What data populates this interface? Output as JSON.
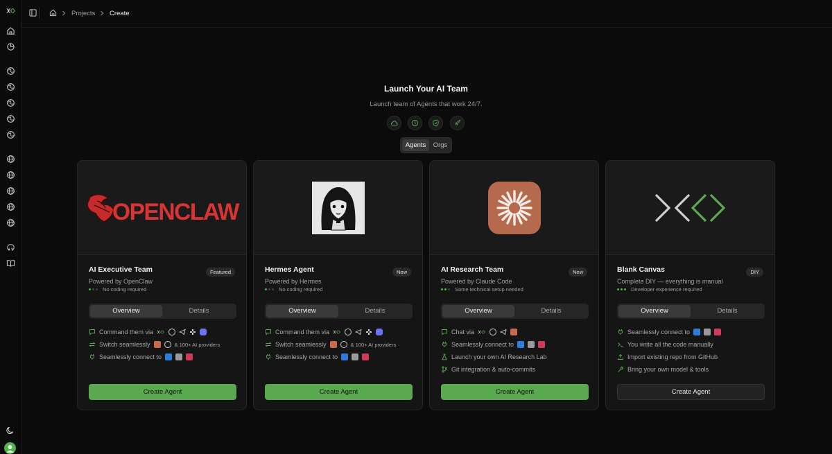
{
  "colors": {
    "accent": "#5aa84f",
    "background": "#0b0b0b",
    "card": "#151515"
  },
  "sidebar": {
    "items": [
      {
        "icon": "home-icon"
      },
      {
        "icon": "chart-pie-icon"
      },
      {
        "icon": "globe-icon"
      },
      {
        "icon": "globe-icon"
      },
      {
        "icon": "globe-icon"
      },
      {
        "icon": "globe-icon"
      },
      {
        "icon": "globe-icon"
      },
      {
        "icon": "globe-icon"
      },
      {
        "icon": "globe-icon"
      },
      {
        "icon": "globe-icon"
      },
      {
        "icon": "globe-icon"
      },
      {
        "icon": "globe-icon"
      },
      {
        "icon": "github-icon"
      },
      {
        "icon": "book-icon"
      },
      {
        "icon": "moon-icon"
      }
    ]
  },
  "header": {
    "breadcrumb": [
      {
        "icon": "home-icon"
      },
      {
        "label": "Projects"
      },
      {
        "label": "Create"
      }
    ]
  },
  "hero": {
    "title": "Launch Your AI Team",
    "subtitle": "Launch team of Agents that work 24/7.",
    "feature_icons": [
      "cloud-icon",
      "clock-icon",
      "shield-icon",
      "rocket-icon"
    ],
    "modes": [
      "Agents",
      "Orgs"
    ],
    "active_mode": "Agents"
  },
  "cards": [
    {
      "title": "AI Executive Team",
      "badge": "Featured",
      "powered_by": "Powered by OpenClaw",
      "difficulty": "No coding required",
      "difficulty_level": 1,
      "logo_text": "OPENCLAW",
      "tabs": [
        "Overview",
        "Details"
      ],
      "features": [
        {
          "icon": "chat-icon",
          "text": "Command them via"
        },
        {
          "icon": "switch-icon",
          "text": "Switch seamlessly",
          "extra": "& 100+ AI providers"
        },
        {
          "icon": "plug-icon",
          "text": "Seamlessly connect to"
        }
      ],
      "cta": "Create Agent"
    },
    {
      "title": "Hermes Agent",
      "badge": "New",
      "powered_by": "Powered by Hermes",
      "difficulty": "No coding required",
      "difficulty_level": 1,
      "tabs": [
        "Overview",
        "Details"
      ],
      "features": [
        {
          "icon": "chat-icon",
          "text": "Command them via"
        },
        {
          "icon": "switch-icon",
          "text": "Switch seamlessly",
          "extra": "& 100+ AI providers"
        },
        {
          "icon": "plug-icon",
          "text": "Seamlessly connect to"
        }
      ],
      "cta": "Create Agent"
    },
    {
      "title": "AI Research Team",
      "badge": "New",
      "powered_by": "Powered by Claude Code",
      "difficulty": "Some technical setup needed",
      "difficulty_level": 2,
      "tabs": [
        "Overview",
        "Details"
      ],
      "features": [
        {
          "icon": "chat-icon",
          "text": "Chat via"
        },
        {
          "icon": "plug-icon",
          "text": "Seamlessly connect to"
        },
        {
          "icon": "flask-icon",
          "text": "Launch your own AI Research Lab"
        },
        {
          "icon": "git-icon",
          "text": "Git integration & auto-commits"
        }
      ],
      "cta": "Create Agent"
    },
    {
      "title": "Blank Canvas",
      "badge": "DIY",
      "powered_by": "Complete DIY — everything is manual",
      "difficulty": "Developer experience required",
      "difficulty_level": 3,
      "tabs": [
        "Overview",
        "Details"
      ],
      "features": [
        {
          "icon": "plug-icon",
          "text": "Seamlessly connect to"
        },
        {
          "icon": "terminal-icon",
          "text": "You write all the code manually"
        },
        {
          "icon": "upload-icon",
          "text": "Import existing repo from GitHub"
        },
        {
          "icon": "wrench-icon",
          "text": "Bring your own model & tools"
        }
      ],
      "cta": "Create Agent"
    }
  ]
}
